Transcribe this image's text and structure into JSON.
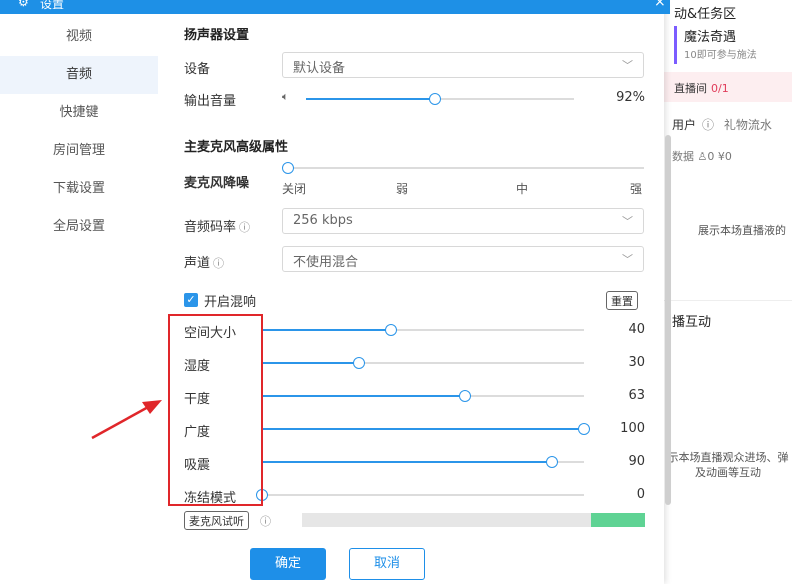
{
  "window": {
    "title": "设置",
    "close": "×"
  },
  "nav": [
    "视频",
    "音频",
    "快捷键",
    "房间管理",
    "下载设置",
    "全局设置"
  ],
  "speaker": {
    "section_title": "扬声器设置",
    "device_label": "设备",
    "device_value": "默认设备",
    "volume_label": "输出音量",
    "volume_value": "92%",
    "volume_level": 0.48
  },
  "mic": {
    "section_title": "主麦克风高级属性",
    "denoise_label": "麦克风降噪",
    "denoise_ticks": [
      "关闭",
      "弱",
      "中",
      "强"
    ],
    "bitrate_label": "音频码率",
    "bitrate_value": "256 kbps",
    "channel_label": "声道",
    "channel_value": "不使用混合",
    "reverb_label": "开启混响",
    "reset_label": "重置",
    "sliders": [
      {
        "label": "空间大小",
        "value": "40",
        "level": 0.4
      },
      {
        "label": "湿度",
        "value": "30",
        "level": 0.3
      },
      {
        "label": "干度",
        "value": "63",
        "level": 0.63
      },
      {
        "label": "广度",
        "value": "100",
        "level": 1.0
      },
      {
        "label": "吸震",
        "value": "90",
        "level": 0.9
      },
      {
        "label": "冻结模式",
        "value": "0",
        "level": 0.0
      }
    ],
    "monitor_label": "麦克风试听"
  },
  "footer": {
    "ok": "确定",
    "cancel": "取消"
  },
  "background": {
    "panel_title": "动&任务区",
    "card_title": "魔法奇遇",
    "card_sub": "10即可参与施法",
    "pink_label": "直播间",
    "pink_count": "0/1",
    "tab_users": "用户",
    "tab_gifts": "礼物流水",
    "stats": "数据  ♙0  ¥0",
    "empty_hint": "展示本场直播液的",
    "section2": "播互动",
    "empty2_line1": "示本场直播观众进场、弹",
    "empty2_line2": "及动画等互动"
  },
  "colors": {
    "accent": "#2b95e9",
    "titlebar": "#1e90e6",
    "meter": "#5fd394",
    "annotation": "#e0262a"
  }
}
